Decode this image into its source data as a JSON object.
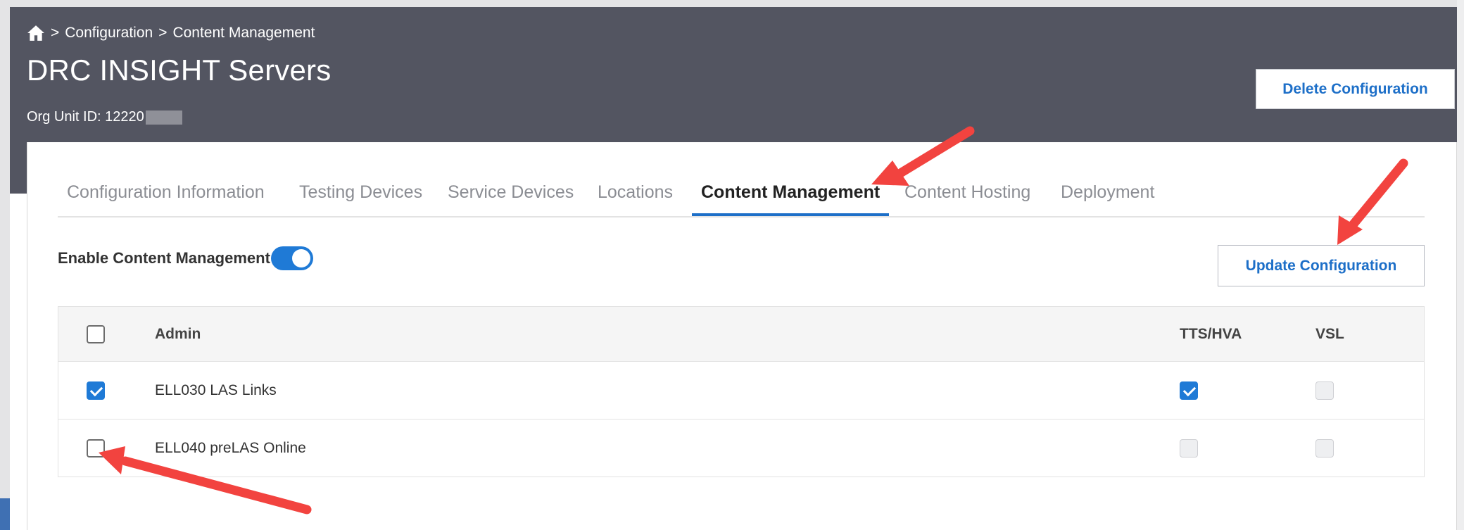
{
  "breadcrumb": {
    "separator": ">",
    "items": [
      "Configuration",
      "Content Management"
    ]
  },
  "page": {
    "title": "DRC INSIGHT Servers",
    "org_unit_label": "Org Unit ID: 12220",
    "org_unit_redacted": true
  },
  "actions": {
    "delete_label": "Delete Configuration",
    "update_label": "Update Configuration"
  },
  "tabs": [
    {
      "label": "Configuration Information",
      "active": false
    },
    {
      "label": "Testing Devices",
      "active": false
    },
    {
      "label": "Service Devices",
      "active": false
    },
    {
      "label": "Locations",
      "active": false
    },
    {
      "label": "Content Management",
      "active": true
    },
    {
      "label": "Content Hosting",
      "active": false
    },
    {
      "label": "Deployment",
      "active": false
    }
  ],
  "content_management": {
    "enable_label": "Enable Content Management",
    "enabled": true
  },
  "table": {
    "columns": {
      "admin": "Admin",
      "tts": "TTS/HVA",
      "vsl": "VSL"
    },
    "select_all_checked": false,
    "rows": [
      {
        "name": "ELL030 LAS Links",
        "selected": true,
        "tts": true,
        "tts_enabled": true,
        "vsl": false,
        "vsl_enabled": false
      },
      {
        "name": "ELL040 preLAS Online",
        "selected": false,
        "tts": false,
        "tts_enabled": false,
        "vsl": false,
        "vsl_enabled": false
      }
    ]
  },
  "icons": {
    "home": "home-icon",
    "annotation": "red-arrow-icon"
  },
  "colors": {
    "header_bg": "#535561",
    "accent": "#1f7ad6",
    "link_blue": "#1d6fc8",
    "annotation_red": "#f2433f"
  }
}
